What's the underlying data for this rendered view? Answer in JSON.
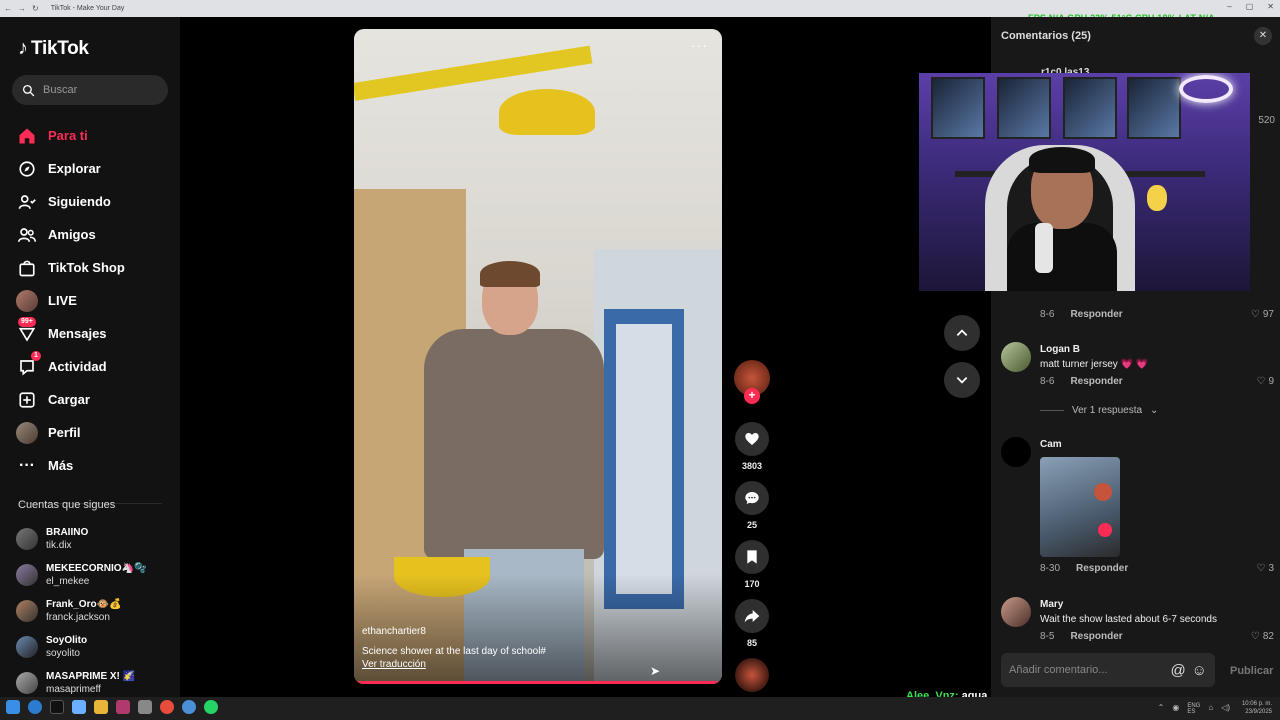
{
  "browser": {
    "tab_title": "TikTok - Make Your Day",
    "overlay_stats": "FPS N/A   GPU 23% 51°C   CPU 18%   LAT N/A"
  },
  "sidebar": {
    "logo": "TikTok",
    "search_placeholder": "Buscar",
    "nav": [
      {
        "label": "Para ti",
        "icon": "home-icon",
        "active": true
      },
      {
        "label": "Explorar",
        "icon": "compass-icon"
      },
      {
        "label": "Siguiendo",
        "icon": "following-icon"
      },
      {
        "label": "Amigos",
        "icon": "friends-icon"
      },
      {
        "label": "TikTok Shop",
        "icon": "shop-icon"
      },
      {
        "label": "LIVE",
        "icon": "live-icon"
      },
      {
        "label": "Mensajes",
        "icon": "messages-icon",
        "badge": "99+"
      },
      {
        "label": "Actividad",
        "icon": "activity-icon",
        "badge": "1"
      },
      {
        "label": "Cargar",
        "icon": "upload-icon"
      },
      {
        "label": "Perfil",
        "icon": "profile-icon"
      },
      {
        "label": "Más",
        "icon": "more-icon"
      }
    ],
    "following_title": "Cuentas que sigues",
    "following": [
      {
        "name": "BRAIINO",
        "handle": "tik.dix"
      },
      {
        "name": "MEKEECORNIO🦄🫧",
        "handle": "el_mekee"
      },
      {
        "name": "Frank_Oro🐵💰",
        "handle": "franck.jackson"
      },
      {
        "name": "SoyOlito",
        "handle": "soyolito"
      },
      {
        "name": "MASAPRIME X! 🌠",
        "handle": "masaprimeff"
      }
    ]
  },
  "video": {
    "author": "ethanchartier8",
    "caption": "Science shower at the last day of school#",
    "translate": "Ver traducción",
    "progress": 1.0
  },
  "actions": {
    "likes": "3803",
    "comments": "25",
    "saves": "170",
    "shares": "85"
  },
  "comments": {
    "title": "Comentarios (25)",
    "partial_user": "r1c0 las13",
    "partial_likes": "520",
    "items": [
      {
        "user": "",
        "text": "",
        "date": "8-6",
        "reply": "Responder",
        "likes": "97"
      },
      {
        "user": "Logan B",
        "text": "matt turner jersey 💗 💗",
        "date": "8-6",
        "reply": "Responder",
        "likes": "9"
      },
      {
        "user": "Cam",
        "text": "",
        "date": "8-30",
        "reply": "Responder",
        "likes": "3"
      },
      {
        "user": "Mary",
        "text": "Wait the show lasted about 6-7 seconds",
        "date": "8-5",
        "reply": "Responder",
        "likes": "82"
      }
    ],
    "view_replies": "Ver 1 respuesta",
    "input_placeholder": "Añadir comentario...",
    "publish": "Publicar"
  },
  "stream_chat": {
    "user": "Alee_Vnz:",
    "message": "agua"
  },
  "taskbar": {
    "lang": "ENG",
    "region": "ES",
    "time": "10:06 p. m.",
    "date": "23/9/2025"
  }
}
